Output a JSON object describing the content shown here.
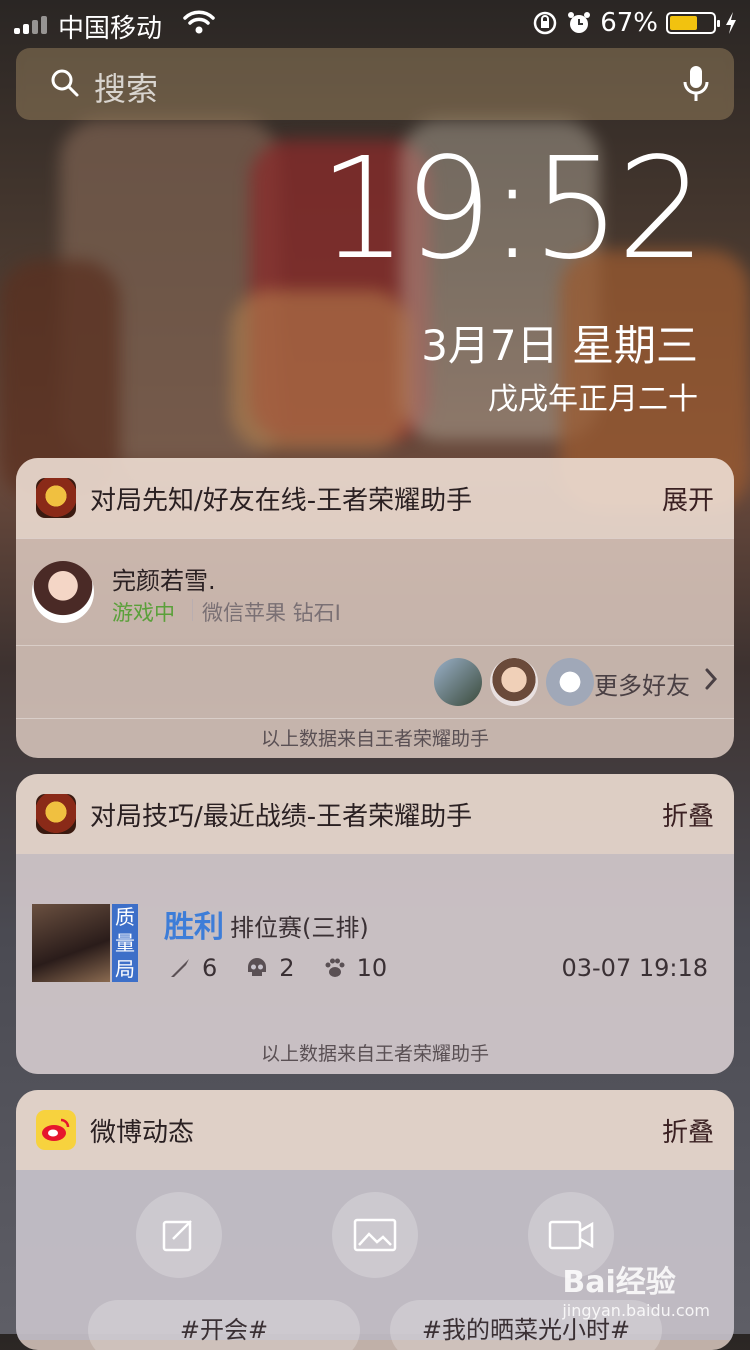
{
  "status_bar": {
    "carrier": "中国移动",
    "battery_percent": "67%",
    "battery_level": 0.67
  },
  "search": {
    "label": "搜索"
  },
  "lock": {
    "time": "19:52",
    "date": "3月7日 星期三",
    "lunar": "戊戌年正月二十"
  },
  "widget1": {
    "title": "对局先知/好友在线-王者荣耀助手",
    "action": "展开",
    "friend": {
      "name": "完颜若雪.",
      "status": "游戏中",
      "info": "微信苹果 钻石I"
    },
    "more_friends": "更多好友",
    "footer": "以上数据来自王者荣耀助手"
  },
  "widget2": {
    "title": "对局技巧/最近战绩-王者荣耀助手",
    "action": "折叠",
    "battle": {
      "badge": "质量局",
      "result": "胜利",
      "mode": "排位赛(三排)",
      "kills": "6",
      "deaths": "2",
      "assists": "10",
      "time": "03-07 19:18"
    },
    "footer": "以上数据来自王者荣耀助手"
  },
  "widget3": {
    "title": "微博动态",
    "action": "折叠",
    "pills": [
      "#开会#",
      "#我的晒菜光小时#"
    ]
  },
  "watermark": {
    "brand": "Bai经验",
    "url": "jingyan.baidu.com"
  }
}
